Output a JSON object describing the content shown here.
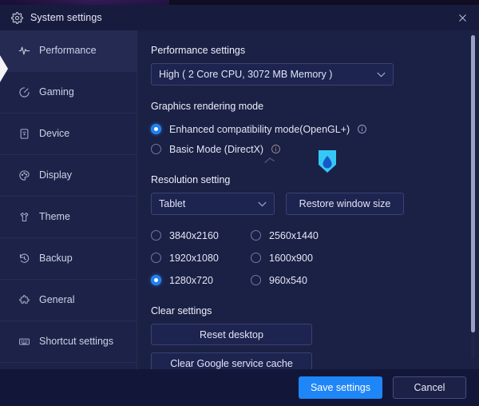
{
  "window": {
    "title": "System settings",
    "gear_icon": "gear-icon",
    "close_icon": "close-icon"
  },
  "sidebar": {
    "items": [
      {
        "label": "Performance",
        "icon": "pulse-icon",
        "active": true
      },
      {
        "label": "Gaming",
        "icon": "gamepad-icon",
        "active": false
      },
      {
        "label": "Device",
        "icon": "device-icon",
        "active": false
      },
      {
        "label": "Display",
        "icon": "palette-icon",
        "active": false
      },
      {
        "label": "Theme",
        "icon": "shirt-icon",
        "active": false
      },
      {
        "label": "Backup",
        "icon": "history-icon",
        "active": false
      },
      {
        "label": "General",
        "icon": "puzzle-icon",
        "active": false
      },
      {
        "label": "Shortcut settings",
        "icon": "keyboard-icon",
        "active": false
      }
    ]
  },
  "content": {
    "performance": {
      "section_label": "Performance settings",
      "selected": "High ( 2 Core CPU, 3072 MB Memory )",
      "chevron_icon": "chevron-down-icon"
    },
    "graphics": {
      "section_label": "Graphics rendering mode",
      "options": [
        {
          "label": "Enhanced compatibility mode(OpenGL+)",
          "selected": true,
          "info_icon": "info-icon"
        },
        {
          "label": "Basic Mode (DirectX)",
          "selected": false,
          "info_icon": "info-icon"
        }
      ]
    },
    "resolution": {
      "section_label": "Resolution setting",
      "preset_selected": "Tablet",
      "restore_label": "Restore window size",
      "options": [
        {
          "label": "3840x2160",
          "selected": false
        },
        {
          "label": "2560x1440",
          "selected": false
        },
        {
          "label": "1920x1080",
          "selected": false
        },
        {
          "label": "1600x900",
          "selected": false
        },
        {
          "label": "1280x720",
          "selected": true
        },
        {
          "label": "960x540",
          "selected": false
        }
      ]
    },
    "clear": {
      "section_label": "Clear settings",
      "reset_desktop_label": "Reset desktop",
      "clear_cache_label": "Clear Google service cache"
    }
  },
  "footer": {
    "save_label": "Save settings",
    "cancel_label": "Cancel"
  },
  "colors": {
    "accent": "#1f86f7",
    "dialog_bg": "#1b2045",
    "sidebar_bg": "#1d2348",
    "titlebar_bg": "#171c3e",
    "footer_bg": "#12173a",
    "border": "#3a4270"
  }
}
